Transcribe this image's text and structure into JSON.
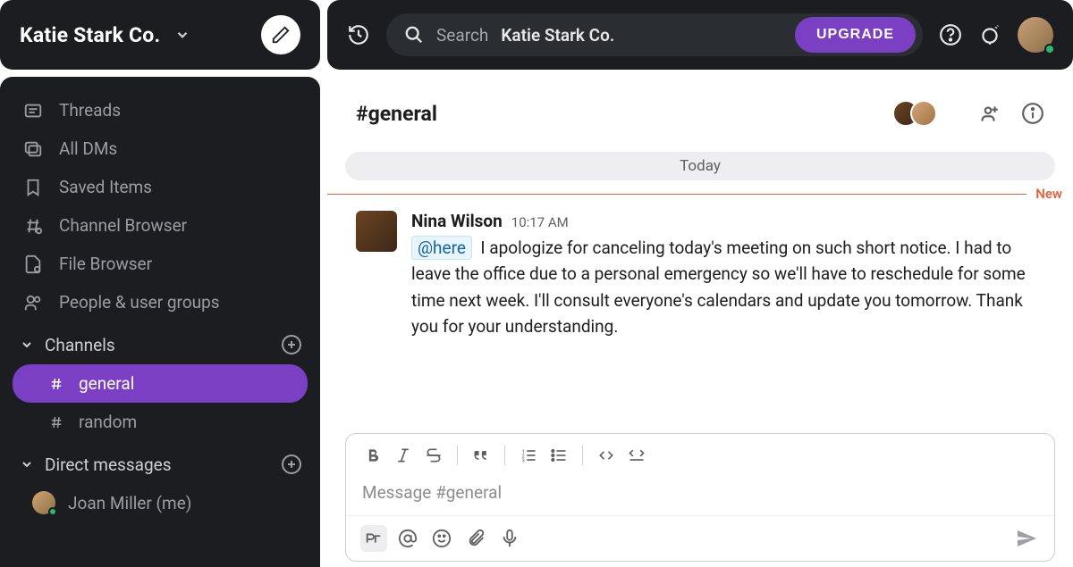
{
  "workspace": {
    "name": "Katie Stark Co."
  },
  "sidebar": {
    "nav": [
      {
        "label": "Threads",
        "icon": "threads"
      },
      {
        "label": "All DMs",
        "icon": "dms"
      },
      {
        "label": "Saved Items",
        "icon": "bookmark"
      },
      {
        "label": "Channel Browser",
        "icon": "channel-browser"
      },
      {
        "label": "File Browser",
        "icon": "file-browser"
      },
      {
        "label": "People & user groups",
        "icon": "people"
      }
    ],
    "channels_label": "Channels",
    "channels": [
      {
        "label": "general",
        "active": true
      },
      {
        "label": "random",
        "active": false
      }
    ],
    "dms_label": "Direct messages",
    "dms": [
      {
        "label": "Joan Miller (me)"
      }
    ]
  },
  "topbar": {
    "search_placeholder": "Search",
    "search_context": "Katie Stark Co.",
    "upgrade_label": "UPGRADE"
  },
  "channel": {
    "title": "#general",
    "date_label": "Today",
    "new_label": "New"
  },
  "message": {
    "author": "Nina Wilson",
    "time": "10:17 AM",
    "mention": "@here",
    "body": "I apologize for canceling today's meeting on such short notice. I had to leave the office due to a personal emergency so we'll have to reschedule for some time next week. I'll consult everyone's calendars and update you tomorrow. Thank you for your understanding."
  },
  "composer": {
    "placeholder": "Message #general"
  }
}
